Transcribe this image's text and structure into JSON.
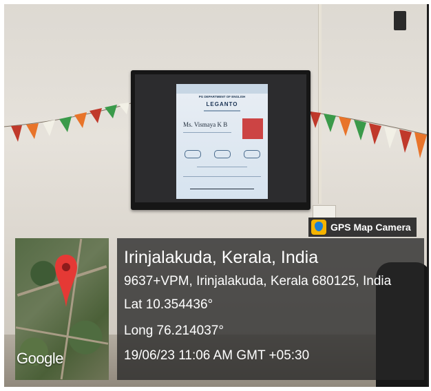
{
  "gps_camera": {
    "app_label": "GPS Map Camera",
    "icon": "map-pin-camera-icon",
    "accent_color": "#f5b400"
  },
  "map_thumbnail": {
    "logo_text": "Google",
    "pin_color": "#e53935"
  },
  "location": {
    "city": "Irinjalakuda, Kerala, India",
    "address": "9637+VPM, Irinjalakuda, Kerala 680125, India",
    "latitude": "Lat 10.354436°",
    "longitude": "Long 76.214037°",
    "timestamp": "19/06/23 11:06 AM GMT +05:30"
  },
  "poster": {
    "department": "PG DEPARTMENT OF ENGLISH",
    "title": "LEGANTO",
    "speaker": "Ms. Vismaya K B"
  }
}
